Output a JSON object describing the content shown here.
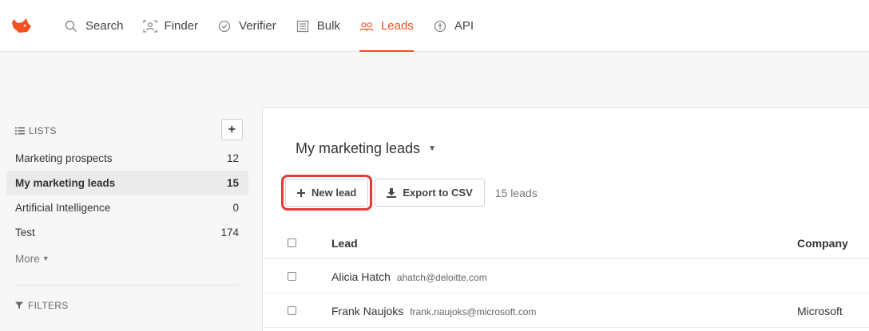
{
  "nav": {
    "items": [
      {
        "label": "Search",
        "icon": "search-icon",
        "active": false
      },
      {
        "label": "Finder",
        "icon": "finder-icon",
        "active": false
      },
      {
        "label": "Verifier",
        "icon": "check-circle-icon",
        "active": false
      },
      {
        "label": "Bulk",
        "icon": "list-icon",
        "active": false
      },
      {
        "label": "Leads",
        "icon": "people-icon",
        "active": true
      },
      {
        "label": "API",
        "icon": "api-icon",
        "active": false
      }
    ]
  },
  "sidebar": {
    "lists_label": "LISTS",
    "add_label": "+",
    "items": [
      {
        "name": "Marketing prospects",
        "count": "12"
      },
      {
        "name": "My marketing leads",
        "count": "15"
      },
      {
        "name": "Artificial Intelligence",
        "count": "0"
      },
      {
        "name": "Test",
        "count": "174"
      }
    ],
    "more_label": "More",
    "filters_label": "FILTERS"
  },
  "main": {
    "list_title": "My marketing leads",
    "new_lead_label": "New lead",
    "export_label": "Export to CSV",
    "leads_count": "15 leads",
    "table": {
      "headers": {
        "lead": "Lead",
        "company": "Company"
      },
      "rows": [
        {
          "name": "Alicia Hatch",
          "email": "ahatch@deloitte.com",
          "company": ""
        },
        {
          "name": "Frank Naujoks",
          "email": "frank.naujoks@microsoft.com",
          "company": "Microsoft"
        }
      ]
    }
  },
  "colors": {
    "accent": "#f4511e",
    "highlight": "#e53935"
  }
}
